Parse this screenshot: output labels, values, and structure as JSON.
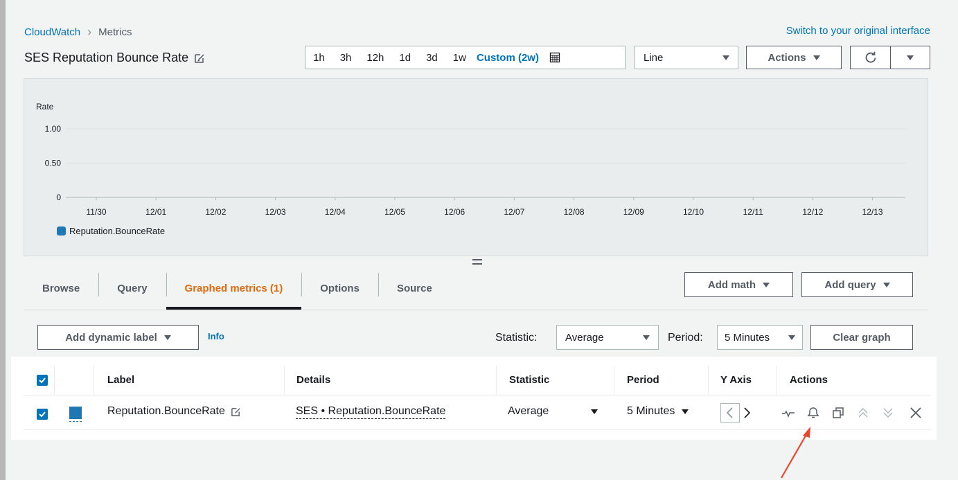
{
  "breadcrumb": {
    "root": "CloudWatch",
    "current": "Metrics"
  },
  "switch_link": "Switch to your original interface",
  "page_title": "SES Reputation Bounce Rate",
  "time_range": {
    "options": [
      "1h",
      "3h",
      "12h",
      "1d",
      "3d",
      "1w"
    ],
    "active": "Custom (2w)"
  },
  "graph_type": "Line",
  "actions_label": "Actions",
  "chart": {
    "ylabel": "Rate",
    "yticks": [
      "1.00",
      "0.50",
      "0"
    ],
    "xticks": [
      "11/30",
      "12/01",
      "12/02",
      "12/03",
      "12/04",
      "12/05",
      "12/06",
      "12/07",
      "12/08",
      "12/09",
      "12/10",
      "12/11",
      "12/12",
      "12/13"
    ],
    "legend": "Reputation.BounceRate",
    "series_color": "#1f77b4"
  },
  "chart_data": {
    "type": "line",
    "ylabel": "Rate",
    "ylim": [
      0,
      1
    ],
    "categories": [
      "11/30",
      "12/01",
      "12/02",
      "12/03",
      "12/04",
      "12/05",
      "12/06",
      "12/07",
      "12/08",
      "12/09",
      "12/10",
      "12/11",
      "12/12",
      "12/13"
    ],
    "series": [
      {
        "name": "Reputation.BounceRate",
        "values": []
      }
    ],
    "grid": true,
    "legend_position": "bottom-left"
  },
  "tabs": [
    "Browse",
    "Query",
    "Graphed metrics (1)",
    "Options",
    "Source"
  ],
  "active_tab": "Graphed metrics (1)",
  "add_math": "Add math",
  "add_query": "Add query",
  "add_dynamic_label": "Add dynamic label",
  "info": "Info",
  "statistic_label": "Statistic:",
  "statistic_value": "Average",
  "period_label": "Period:",
  "period_value": "5 Minutes",
  "clear_graph": "Clear graph",
  "table": {
    "headers": {
      "label": "Label",
      "details": "Details",
      "statistic": "Statistic",
      "period": "Period",
      "yaxis": "Y Axis",
      "actions": "Actions"
    },
    "row": {
      "label": "Reputation.BounceRate",
      "details": "SES • Reputation.BounceRate",
      "statistic": "Average",
      "period": "5 Minutes",
      "color": "#1f77b4"
    }
  },
  "accent_color": "#0073bb",
  "active_tab_color": "#dd6b10"
}
